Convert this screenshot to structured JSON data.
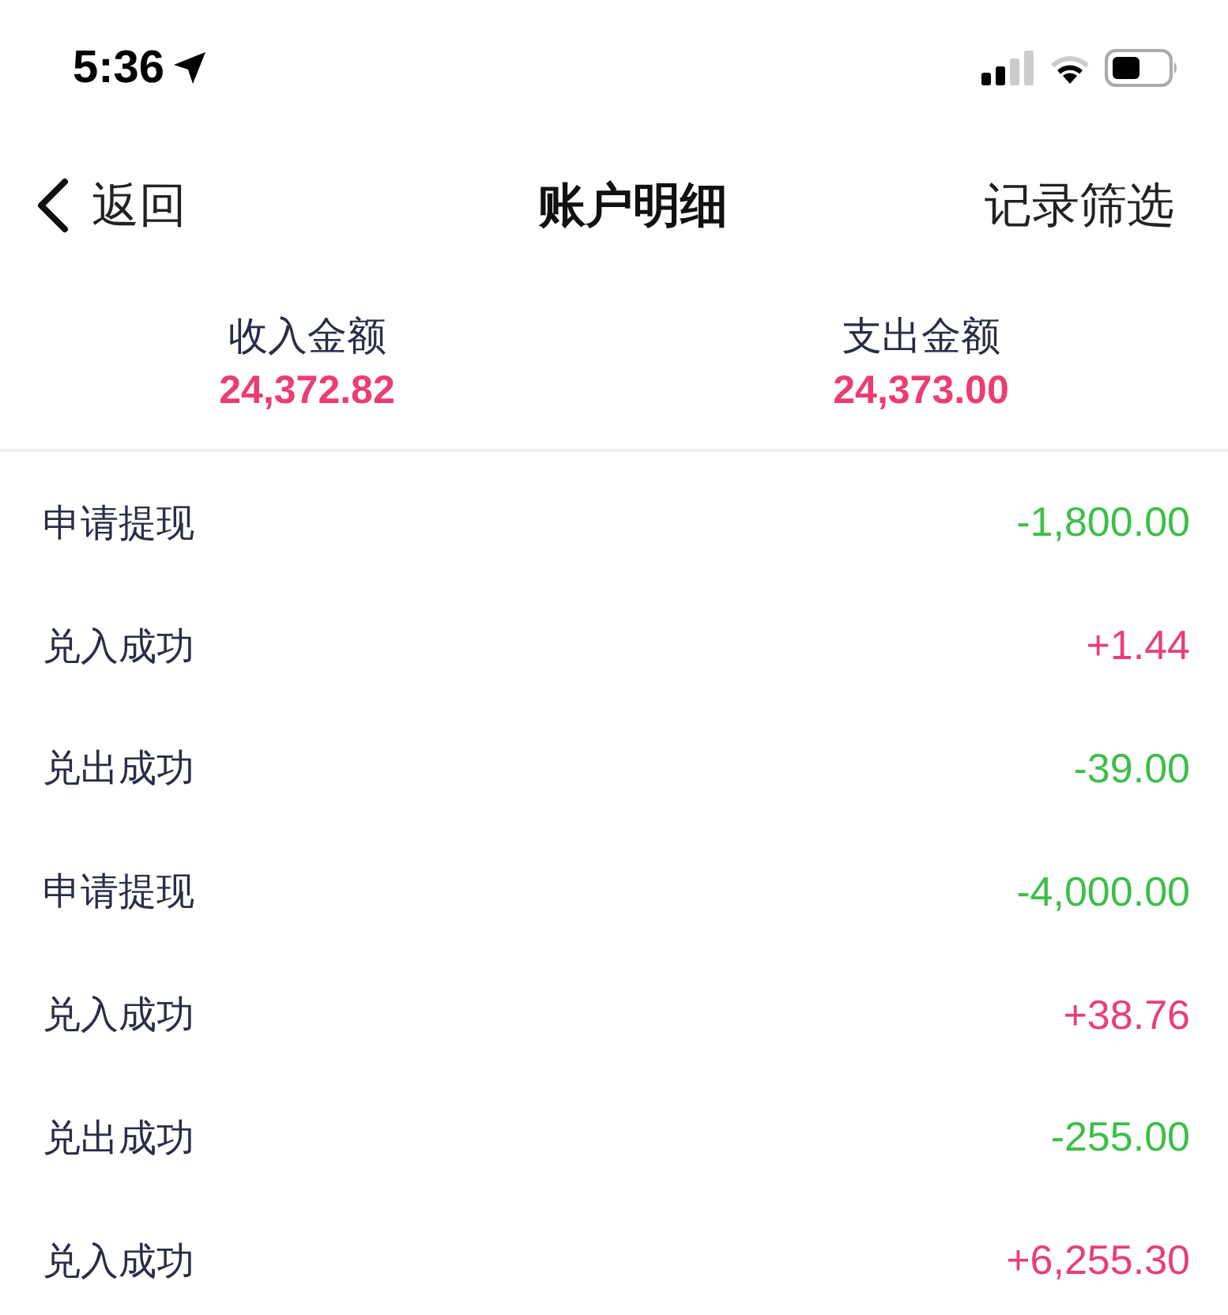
{
  "status_bar": {
    "time": "5:36"
  },
  "nav": {
    "back": "返回",
    "title": "账户明细",
    "action": "记录筛选"
  },
  "summary": [
    {
      "label": "收入金额",
      "amount": "24,372.82"
    },
    {
      "label": "支出金额",
      "amount": "24,373.00"
    }
  ],
  "records": [
    {
      "name": "申请提现",
      "amount": "-1,800.00",
      "kind": "out"
    },
    {
      "name": "兑入成功",
      "amount": "+1.44",
      "kind": "in"
    },
    {
      "name": "兑出成功",
      "amount": "-39.00",
      "kind": "out"
    },
    {
      "name": "申请提现",
      "amount": "-4,000.00",
      "kind": "out"
    },
    {
      "name": "兑入成功",
      "amount": "+38.76",
      "kind": "in"
    },
    {
      "name": "兑出成功",
      "amount": "-255.00",
      "kind": "out"
    },
    {
      "name": "兑入成功",
      "amount": "+6,255.30",
      "kind": "in"
    }
  ]
}
